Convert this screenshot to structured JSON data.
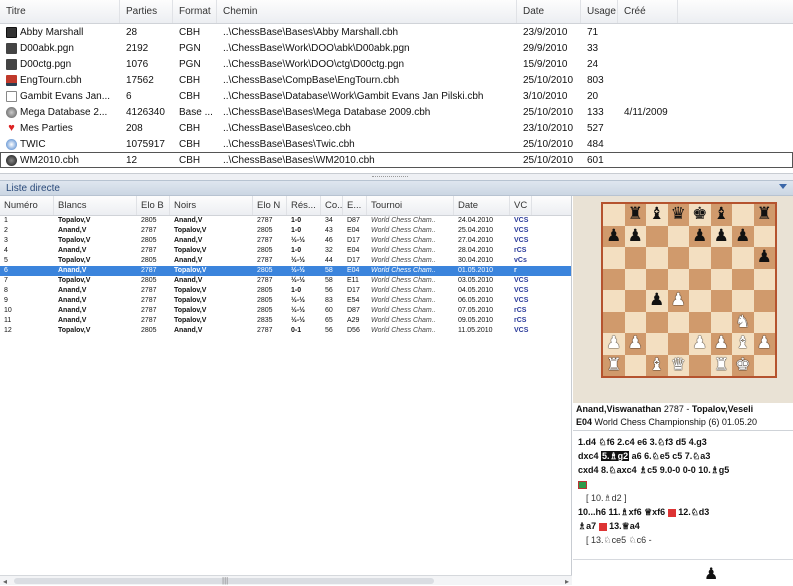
{
  "db_columns": [
    "Titre",
    "Parties",
    "Format",
    "Chemin",
    "Date",
    "Usage",
    "Créé"
  ],
  "databases": [
    {
      "icon": "cbh-icon",
      "titre": "Abby Marshall",
      "parties": "28",
      "format": "CBH",
      "chemin": "..\\ChessBase\\Bases\\Abby Marshall.cbh",
      "date": "23/9/2010",
      "usage": "71",
      "cree": ""
    },
    {
      "icon": "pgn-icon",
      "titre": "D00abk.pgn",
      "parties": "2192",
      "format": "PGN",
      "chemin": "..\\ChessBase\\Work\\DOO\\abk\\D00abk.pgn",
      "date": "29/9/2010",
      "usage": "33",
      "cree": ""
    },
    {
      "icon": "pgn-icon",
      "titre": "D00ctg.pgn",
      "parties": "1076",
      "format": "PGN",
      "chemin": "..\\ChessBase\\Work\\DOO\\ctg\\D00ctg.pgn",
      "date": "15/9/2010",
      "usage": "24",
      "cree": ""
    },
    {
      "icon": "engine-icon",
      "titre": "EngTourn.cbh",
      "parties": "17562",
      "format": "CBH",
      "chemin": "..\\ChessBase\\CompBase\\EngTourn.cbh",
      "date": "25/10/2010",
      "usage": "803",
      "cree": ""
    },
    {
      "icon": "document-icon",
      "titre": "Gambit Evans Jan...",
      "parties": "6",
      "format": "CBH",
      "chemin": "..\\ChessBase\\Database\\Work\\Gambit Evans Jan Pilski.cbh",
      "date": "3/10/2010",
      "usage": "20",
      "cree": ""
    },
    {
      "icon": "mega-database-icon",
      "titre": "Mega Database 2...",
      "parties": "4126340",
      "format": "Base ...",
      "chemin": "..\\ChessBase\\Bases\\Mega Database 2009.cbh",
      "date": "25/10/2010",
      "usage": "133",
      "cree": "4/11/2009"
    },
    {
      "icon": "heart-icon",
      "titre": "Mes Parties",
      "parties": "208",
      "format": "CBH",
      "chemin": "..\\ChessBase\\Bases\\ceo.cbh",
      "date": "23/10/2010",
      "usage": "527",
      "cree": ""
    },
    {
      "icon": "globe-icon",
      "titre": "TWIC",
      "parties": "1075917",
      "format": "CBH",
      "chemin": "..\\ChessBase\\Bases\\Twic.cbh",
      "date": "25/10/2010",
      "usage": "484",
      "cree": ""
    },
    {
      "icon": "ball-icon",
      "titre": "WM2010.cbh",
      "parties": "12",
      "format": "CBH",
      "chemin": "..\\ChessBase\\Bases\\WM2010.cbh",
      "date": "25/10/2010",
      "usage": "601",
      "cree": ""
    }
  ],
  "selected_database": 8,
  "list_bar_label": "Liste directe",
  "game_columns": [
    "Numéro",
    "Blancs",
    "Elo B",
    "Noirs",
    "Elo N",
    "Rés...",
    "Co...",
    "E...",
    "Tournoi",
    "Date",
    "VC"
  ],
  "games": [
    {
      "num": "1",
      "white": "Topalov,V",
      "elo_w": "2805",
      "black": "Anand,V",
      "elo_b": "2787",
      "res": "1-0",
      "moves": "34",
      "eco": "D87",
      "event": "World Chess Cham..",
      "date": "24.04.2010",
      "vc": "VCS"
    },
    {
      "num": "2",
      "white": "Anand,V",
      "elo_w": "2787",
      "black": "Topalov,V",
      "elo_b": "2805",
      "res": "1-0",
      "moves": "43",
      "eco": "E04",
      "event": "World Chess Cham..",
      "date": "25.04.2010",
      "vc": "VCS"
    },
    {
      "num": "3",
      "white": "Topalov,V",
      "elo_w": "2805",
      "black": "Anand,V",
      "elo_b": "2787",
      "res": "½-½",
      "moves": "46",
      "eco": "D17",
      "event": "World Chess Cham..",
      "date": "27.04.2010",
      "vc": "VCS"
    },
    {
      "num": "4",
      "white": "Anand,V",
      "elo_w": "2787",
      "black": "Topalov,V",
      "elo_b": "2805",
      "res": "1-0",
      "moves": "32",
      "eco": "E04",
      "event": "World Chess Cham..",
      "date": "28.04.2010",
      "vc": "rCS"
    },
    {
      "num": "5",
      "white": "Topalov,V",
      "elo_w": "2805",
      "black": "Anand,V",
      "elo_b": "2787",
      "res": "½-½",
      "moves": "44",
      "eco": "D17",
      "event": "World Chess Cham..",
      "date": "30.04.2010",
      "vc": "vCs"
    },
    {
      "num": "6",
      "white": "Anand,V",
      "elo_w": "2787",
      "black": "Topalov,V",
      "elo_b": "2805",
      "res": "½-½",
      "moves": "58",
      "eco": "E04",
      "event": "World Chess Cham..",
      "date": "01.05.2010",
      "vc": "r"
    },
    {
      "num": "7",
      "white": "Topalov,V",
      "elo_w": "2805",
      "black": "Anand,V",
      "elo_b": "2787",
      "res": "½-½",
      "moves": "58",
      "eco": "E11",
      "event": "World Chess Cham..",
      "date": "03.05.2010",
      "vc": "VCS"
    },
    {
      "num": "8",
      "white": "Anand,V",
      "elo_w": "2787",
      "black": "Topalov,V",
      "elo_b": "2805",
      "res": "1-0",
      "moves": "56",
      "eco": "D17",
      "event": "World Chess Cham..",
      "date": "04.05.2010",
      "vc": "VCS"
    },
    {
      "num": "9",
      "white": "Anand,V",
      "elo_w": "2787",
      "black": "Topalov,V",
      "elo_b": "2805",
      "res": "½-½",
      "moves": "83",
      "eco": "E54",
      "event": "World Chess Cham..",
      "date": "06.05.2010",
      "vc": "VCS"
    },
    {
      "num": "10",
      "white": "Anand,V",
      "elo_w": "2787",
      "black": "Topalov,V",
      "elo_b": "2805",
      "res": "½-½",
      "moves": "60",
      "eco": "D87",
      "event": "World Chess Cham..",
      "date": "07.05.2010",
      "vc": "rCS"
    },
    {
      "num": "11",
      "white": "Anand,V",
      "elo_w": "2787",
      "black": "Topalov,V",
      "elo_b": "2835",
      "res": "½-½",
      "moves": "65",
      "eco": "A29",
      "event": "World Chess Cham..",
      "date": "09.05.2010",
      "vc": "rCS"
    },
    {
      "num": "12",
      "white": "Topalov,V",
      "elo_w": "2805",
      "black": "Anand,V",
      "elo_b": "2787",
      "res": "0-1",
      "moves": "56",
      "eco": "D56",
      "event": "World Chess Cham..",
      "date": "11.05.2010",
      "vc": "VCS"
    }
  ],
  "selected_game": 5,
  "scrollbar_mid_glyph": "|||",
  "board": [
    [
      "",
      "r",
      "b",
      "q",
      "k",
      "b",
      "",
      "r"
    ],
    [
      "p",
      "p",
      "",
      "",
      "p",
      "p",
      "p",
      ""
    ],
    [
      "",
      "",
      "",
      "",
      "",
      "",
      "",
      "p"
    ],
    [
      "",
      "",
      "",
      "",
      "",
      "",
      "",
      ""
    ],
    [
      "",
      "",
      "p",
      "P",
      "",
      "",
      "",
      ""
    ],
    [
      "",
      "",
      "",
      "",
      "",
      "",
      "N",
      ""
    ],
    [
      "P",
      "P",
      "",
      "",
      "P",
      "P",
      "B",
      "P"
    ],
    [
      "R",
      "",
      "B",
      "Q",
      "",
      "R",
      "K",
      ""
    ]
  ],
  "players": {
    "white": "Anand,Viswanathan",
    "white_elo": "2787",
    "separator": " - ",
    "black": "Topalov,Veseli",
    "eco": "E04",
    "event": "World Chess Championship (6) 01.05.20"
  },
  "notation": {
    "line1": "1.d4 ♘f6 2.c4 e6 3.♘f3 d5 4.g3",
    "line2a": "dxc4",
    "selected_move": "5.♗g2",
    "line2b": "a6 6.♘e5 c5 7.♘a3",
    "line3": "cxd4 8.♘axc4 ♗c5 9.0-0 0-0 10.♗g5",
    "var1": "[ 10.♗d2 ]",
    "line4": "10...h6 11.♗xf6 ♕xf6",
    "line4b": "12.♘d3",
    "line5a": "♗a7",
    "line5b": "13.♕a4",
    "var2": "[ 13.♘ce5 ♘c6 -"
  },
  "bottom_piece": "♟"
}
